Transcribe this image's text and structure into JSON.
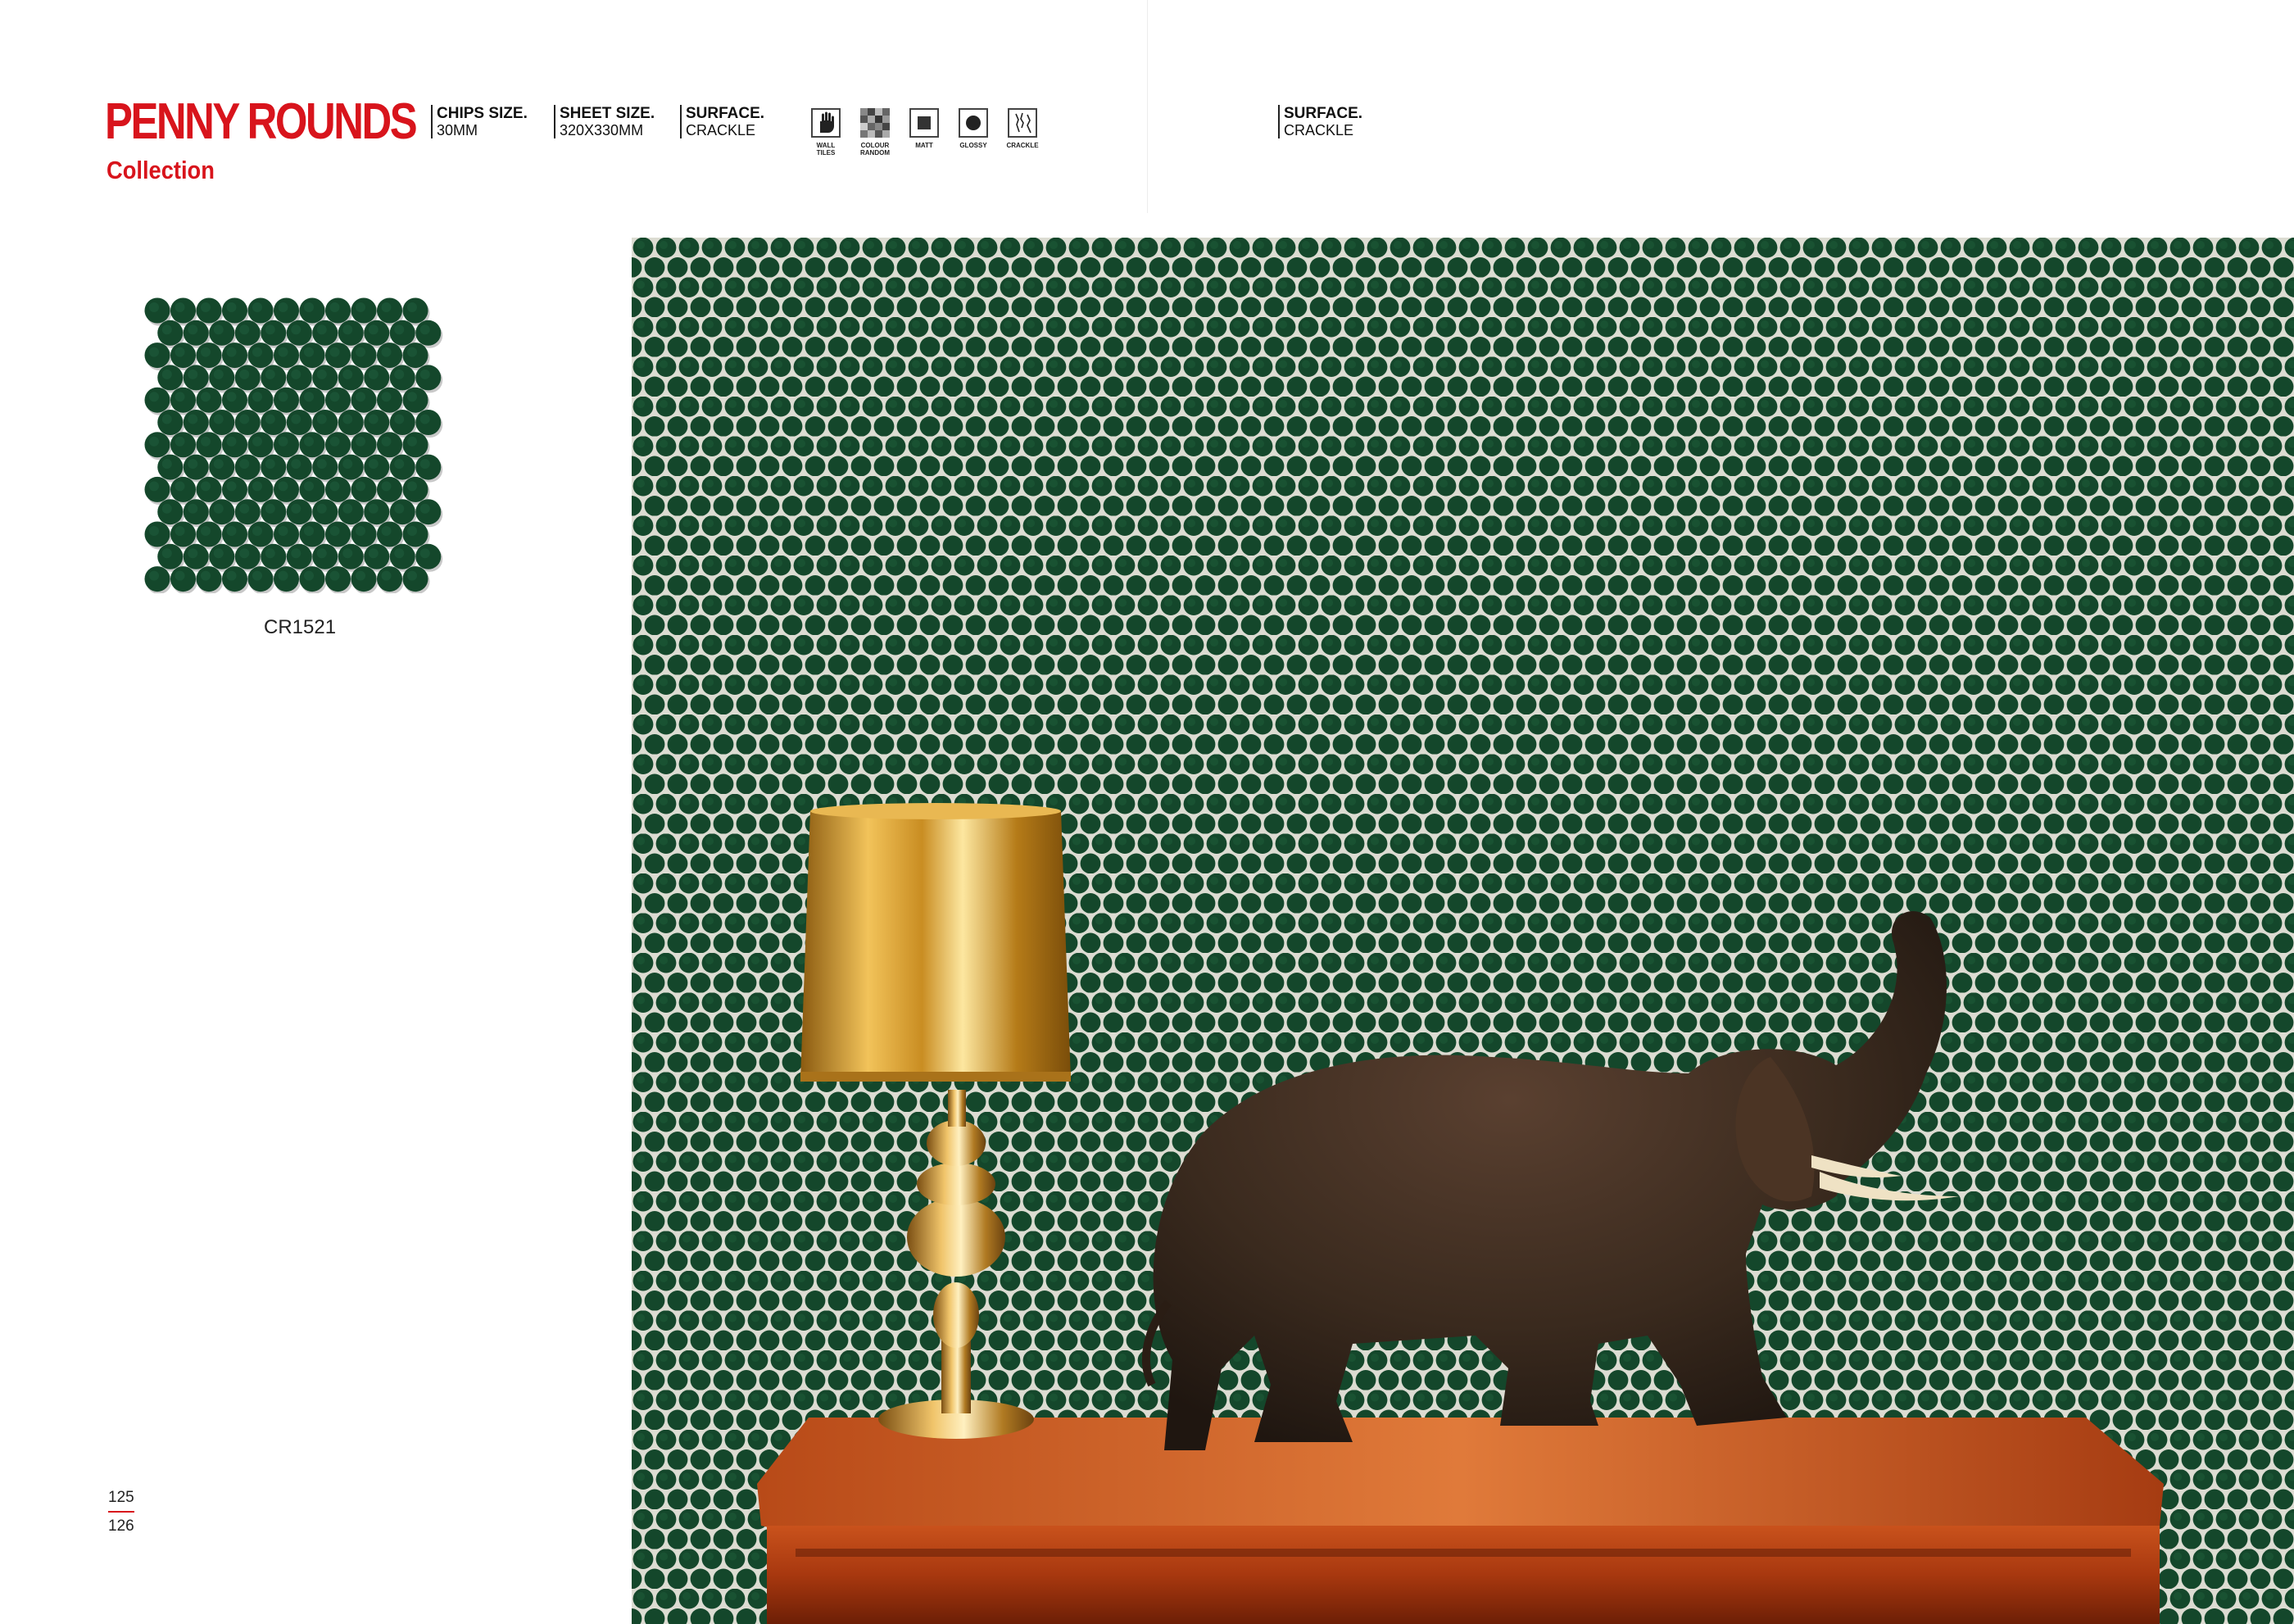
{
  "brand": {
    "title": "PENNY ROUNDS",
    "subtitle": "Collection",
    "accent_color": "#d8141c"
  },
  "specs": [
    {
      "label": "CHIPS SIZE.",
      "value": "30MM"
    },
    {
      "label": "SHEET SIZE.",
      "value": "320X330MM"
    },
    {
      "label": "SURFACE.",
      "value": "CRACKLE"
    }
  ],
  "right_spec": {
    "label": "SURFACE.",
    "value": "CRACKLE"
  },
  "feature_icons": [
    {
      "name": "wall-tiles-icon",
      "caption_line1": "WALL",
      "caption_line2": "TILES"
    },
    {
      "name": "colour-random-icon",
      "caption_line1": "COLOUR",
      "caption_line2": "RANDOM"
    },
    {
      "name": "matt-icon",
      "caption_line1": "MATT",
      "caption_line2": ""
    },
    {
      "name": "glossy-icon",
      "caption_line1": "GLOSSY",
      "caption_line2": ""
    },
    {
      "name": "crackle-icon",
      "caption_line1": "CRACKLE",
      "caption_line2": ""
    }
  ],
  "product": {
    "code": "CR1521",
    "tile_color": "#14472b"
  },
  "pages": {
    "left": "125",
    "right": "126"
  }
}
